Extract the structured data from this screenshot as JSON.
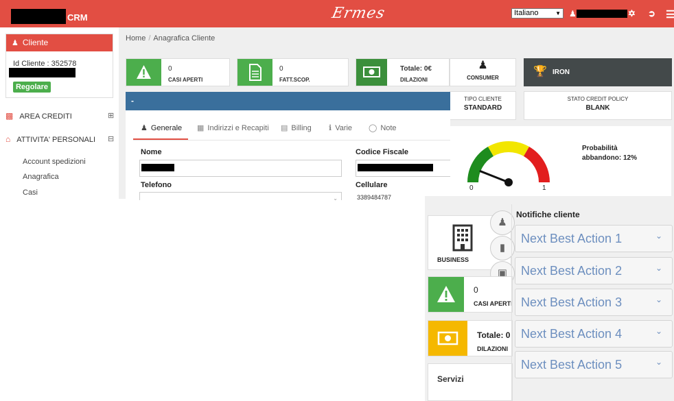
{
  "topbar": {
    "app_name": "CRM",
    "brand_script": "Ermes",
    "language": "Italiano",
    "colors": {
      "accent": "#e24e43"
    }
  },
  "sidebar": {
    "cliente_title": "Cliente",
    "cliente_id": "Id Cliente : 352578",
    "status_badge": "Regolare",
    "items": [
      {
        "label": "AREA CREDITI",
        "icon": "money-icon",
        "toggle": "⊞"
      },
      {
        "label": "ATTIVITA' PERSONALI",
        "icon": "home-icon",
        "toggle": "⊟"
      }
    ],
    "subitems": [
      "Account spedizioni",
      "Anagrafica",
      "Casi"
    ]
  },
  "breadcrumb": {
    "home": "Home",
    "separator": "/",
    "current": "Anagrafica Cliente"
  },
  "stats": {
    "casi_aperti": {
      "value": "0",
      "label": "CASI APERTI"
    },
    "fatt_scop": {
      "value": "0",
      "label": "FATT.SCOP."
    },
    "dilazioni": {
      "value": "Totale: 0€",
      "label": "DILAZIONI"
    },
    "consumer": {
      "label": "CONSUMER"
    },
    "iron": {
      "label": "IRON"
    }
  },
  "info": {
    "tipo_cliente_label": "TIPO CLIENTE",
    "tipo_cliente_value": "STANDARD",
    "stato_credit_policy_label": "STATO CREDIT POLICY",
    "stato_credit_policy_value": "BLANK"
  },
  "blue_bar": {
    "title": "-"
  },
  "tabs": [
    {
      "label": "Generale",
      "icon": "user-icon"
    },
    {
      "label": "Indirizzi e Recapiti",
      "icon": "table-icon"
    },
    {
      "label": "Billing",
      "icon": "book-icon"
    },
    {
      "label": "Varie",
      "icon": "info-icon"
    },
    {
      "label": "Note",
      "icon": "comment-icon"
    }
  ],
  "form": {
    "nome_label": "Nome",
    "codice_fiscale_label": "Codice Fiscale",
    "telefono_label": "Telefono",
    "cellulare_label": "Cellulare",
    "cellulare_partial": "3389484787"
  },
  "gauge": {
    "min_label": "0",
    "max_label": "1",
    "value": 0.12,
    "probability_text": "Probabilità abbandono: 12%",
    "colors": {
      "green": "#1e8c1e",
      "yellow": "#f2e600",
      "red": "#e21e1e"
    }
  },
  "overlay": {
    "business_label": "BUSINESS",
    "casi": {
      "value": "0",
      "label": "CASI APERTI"
    },
    "dilazioni": {
      "value": "Totale: 0",
      "label": "DILAZIONI"
    },
    "servizi_label": "Servizi",
    "notifiche_title": "Notifiche cliente",
    "next_best_actions": [
      "Next Best Action 1",
      "Next Best Action 2",
      "Next Best Action 3",
      "Next Best Action 4",
      "Next Best Action 5"
    ]
  }
}
